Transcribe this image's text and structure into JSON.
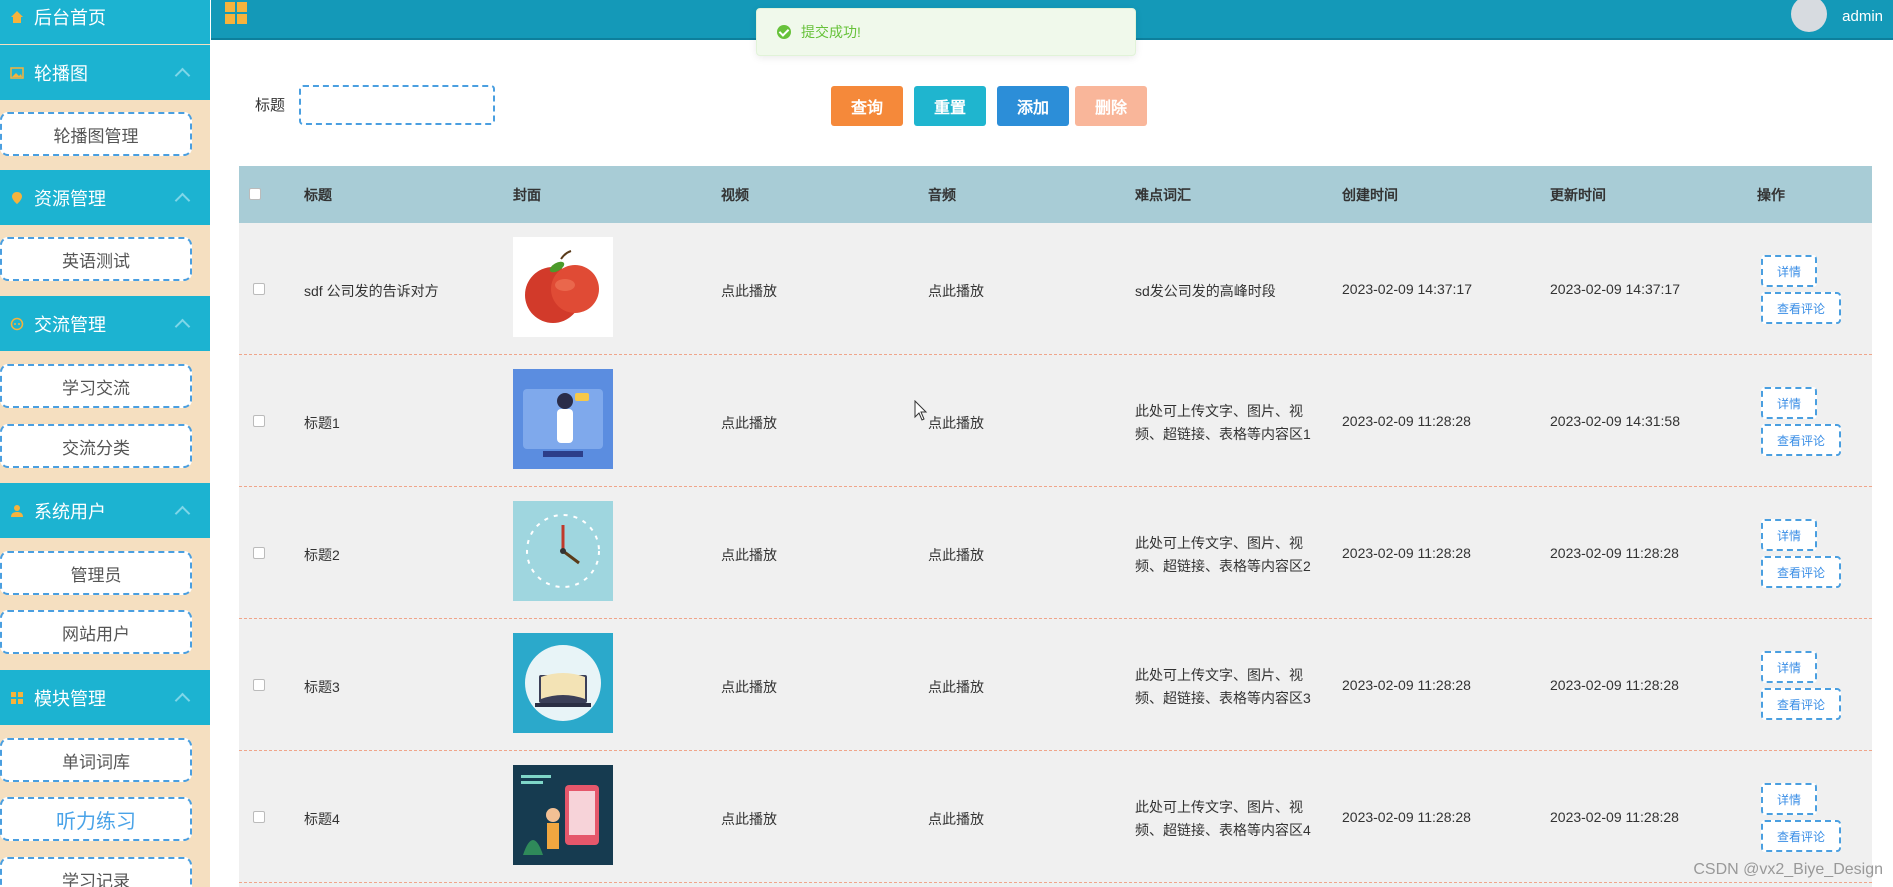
{
  "sidebar": {
    "home": "后台首页",
    "groups": [
      {
        "label": "轮播图",
        "icon": "image-icon",
        "items": [
          "轮播图管理"
        ]
      },
      {
        "label": "资源管理",
        "icon": "pin-icon",
        "items": [
          "英语测试"
        ]
      },
      {
        "label": "交流管理",
        "icon": "chat-icon",
        "items": [
          "学习交流",
          "交流分类"
        ]
      },
      {
        "label": "系统用户",
        "icon": "user-icon",
        "items": [
          "管理员",
          "网站用户"
        ]
      },
      {
        "label": "模块管理",
        "icon": "grid-icon",
        "items": [
          "单词词库",
          "听力练习",
          "学习记录"
        ]
      }
    ],
    "active_item": "听力练习"
  },
  "topbar": {
    "username": "admin"
  },
  "toast": {
    "message": "提交成功!"
  },
  "search": {
    "label": "标题",
    "value": ""
  },
  "buttons": {
    "query": "查询",
    "reset": "重置",
    "add": "添加",
    "delete": "删除"
  },
  "colors": {
    "sidebar_head": "#1cb3d1",
    "topbar": "#1499b8",
    "query": "#f5893a",
    "reset": "#1fb5cf",
    "add": "#2c8ed8",
    "delete": "#f9b69a",
    "success": "#67c23a"
  },
  "table": {
    "headers": [
      "标题",
      "封面",
      "视频",
      "音频",
      "难点词汇",
      "创建时间",
      "更新时间",
      "操作"
    ],
    "rows": [
      {
        "title": "sdf 公司发的告诉对方",
        "cover": "apple-image",
        "video": "点此播放",
        "audio": "点此播放",
        "vocab_line1": "sd发公司发的高峰时段",
        "vocab_line2": "",
        "created": "2023-02-09 14:37:17",
        "updated": "2023-02-09 14:37:17"
      },
      {
        "title": "标题1",
        "cover": "teacher-illustration",
        "video": "点此播放",
        "audio": "点此播放",
        "vocab_line1": "此处可上传文字、图片、视",
        "vocab_line2": "频、超链接、表格等内容区1",
        "created": "2023-02-09 11:28:28",
        "updated": "2023-02-09 14:31:58"
      },
      {
        "title": "标题2",
        "cover": "clock-illustration",
        "video": "点此播放",
        "audio": "点此播放",
        "vocab_line1": "此处可上传文字、图片、视",
        "vocab_line2": "频、超链接、表格等内容区2",
        "created": "2023-02-09 11:28:28",
        "updated": "2023-02-09 11:28:28"
      },
      {
        "title": "标题3",
        "cover": "online-education-illustration",
        "video": "点此播放",
        "audio": "点此播放",
        "vocab_line1": "此处可上传文字、图片、视",
        "vocab_line2": "频、超链接、表格等内容区3",
        "created": "2023-02-09 11:28:28",
        "updated": "2023-02-09 11:28:28"
      },
      {
        "title": "标题4",
        "cover": "language-app-illustration",
        "video": "点此播放",
        "audio": "点此播放",
        "vocab_line1": "此处可上传文字、图片、视",
        "vocab_line2": "频、超链接、表格等内容区4",
        "created": "2023-02-09 11:28:28",
        "updated": "2023-02-09 11:28:28"
      }
    ],
    "actions": {
      "detail": "详情",
      "comments": "查看评论"
    }
  },
  "watermark": "CSDN @vx2_Biye_Design"
}
